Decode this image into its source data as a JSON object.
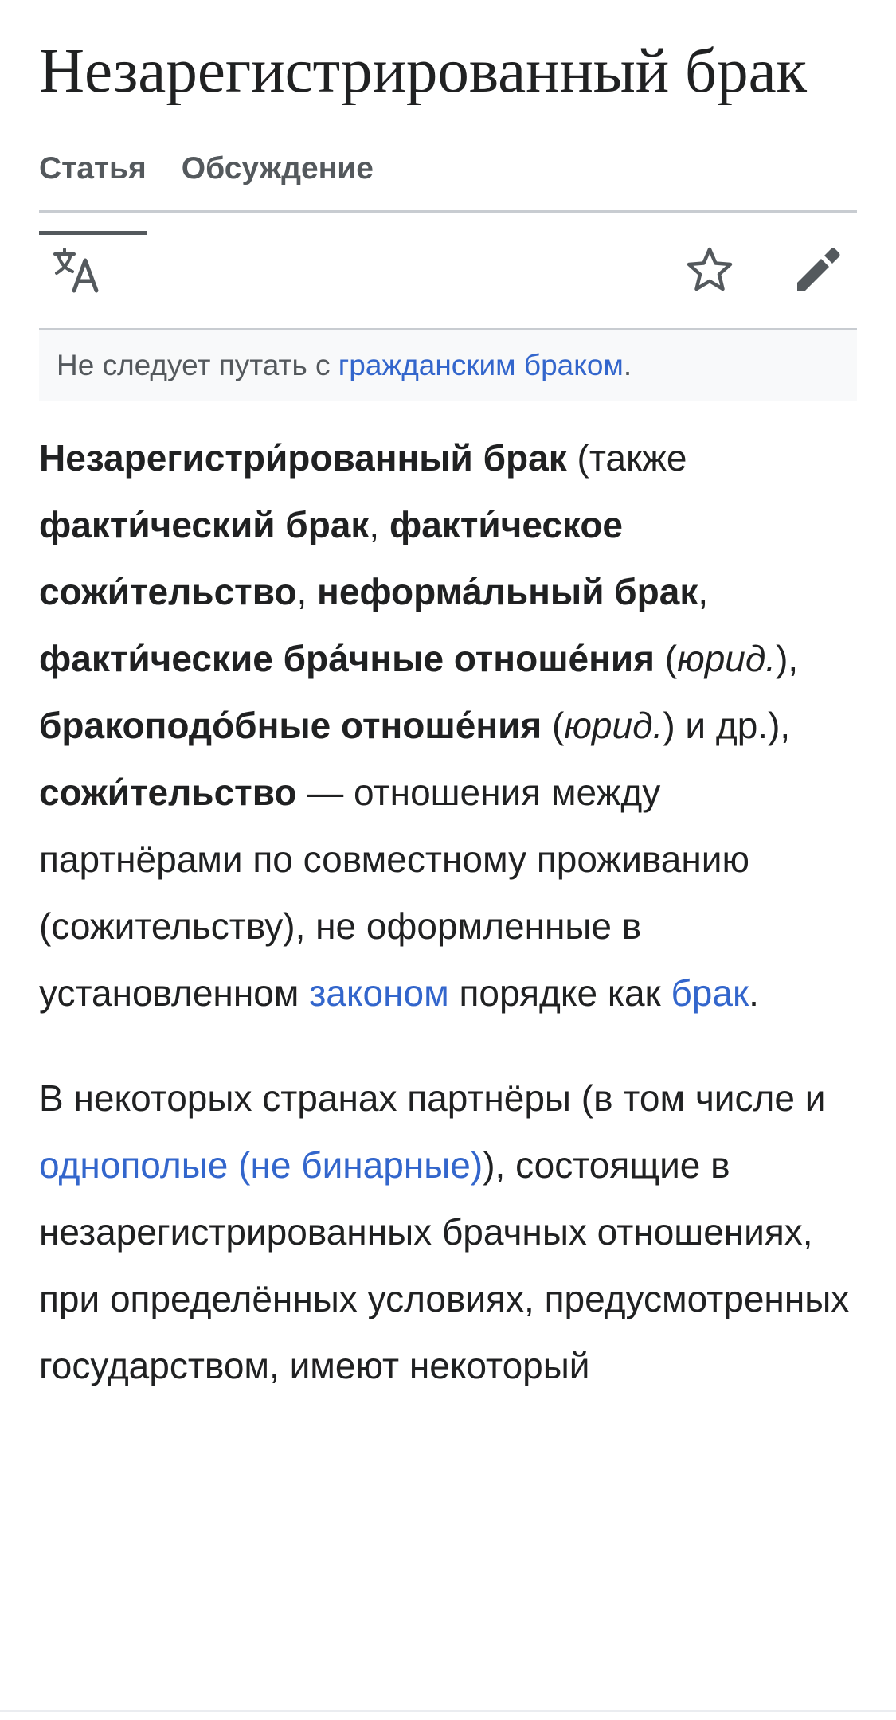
{
  "page": {
    "title": "Незарегистрированный брак"
  },
  "tabs": [
    {
      "label": "Статья",
      "active": true
    },
    {
      "label": "Обсуждение",
      "active": false
    }
  ],
  "toolbar": {
    "icons": [
      "language-icon",
      "star-icon",
      "edit-icon"
    ]
  },
  "hatnote": {
    "prefix": "Не следует путать с ",
    "link": "гражданским браком",
    "suffix": "."
  },
  "paragraph1": {
    "b1": "Незарегистри́рованный брак",
    "t1": " (также ",
    "b2": "факти́ческий брак",
    "t2": ", ",
    "b3": "факти́ческое сожи́тельство",
    "t3": ", ",
    "b4": "неформа́льный брак",
    "t4": ", ",
    "b5": "факти́ческие бра́чные отноше́ния",
    "t5": " (",
    "i1": "юрид.",
    "t6": "), ",
    "b6": "бракоподо́бные отноше́ния",
    "t7": " (",
    "i2": "юрид.",
    "t8": ") и др.), ",
    "b7": "сожи́тельство",
    "t9": " — отношения между партнёрами по совместному проживанию (сожительству), не оформленные в установленном ",
    "link1": "законом",
    "t10": " порядке как ",
    "link2": "брак",
    "t11": "."
  },
  "paragraph2": {
    "t1": "В некоторых странах партнёры (в том числе и ",
    "link1": "однополые (не бинарные)",
    "t2": "), состоящие в незарегистрированных брачных отношениях, при определённых условиях, предусмотренных государством, имеют некоторый"
  },
  "colors": {
    "link": "#3366cc",
    "text": "#202122",
    "muted": "#54595d",
    "divider": "#c8ccd1",
    "hatnote_bg": "#f8f9fa"
  }
}
